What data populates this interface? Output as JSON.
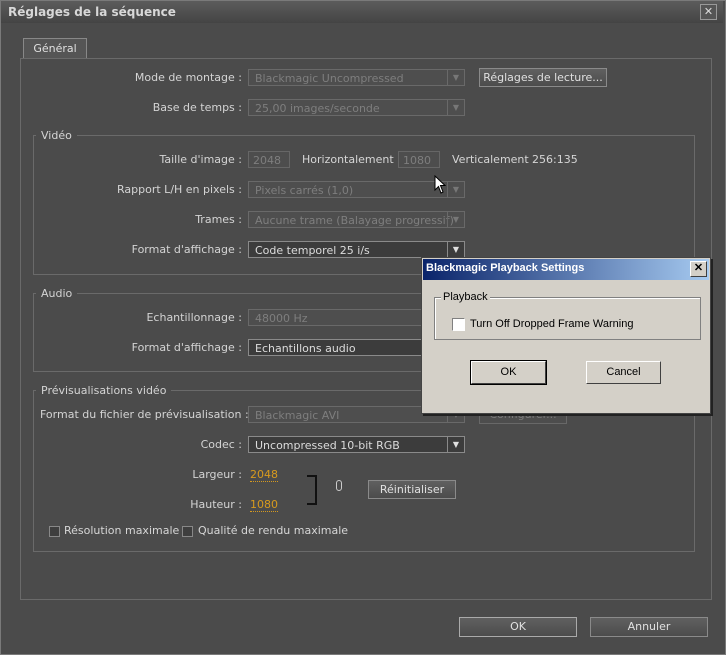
{
  "window": {
    "title": "Réglages de la séquence",
    "close_glyph": "✕"
  },
  "tab": {
    "label": "Général"
  },
  "general": {
    "mode_label": "Mode de montage :",
    "mode_value": "Blackmagic Uncompressed",
    "playback_button": "Réglages de lecture...",
    "timebase_label": "Base de temps :",
    "timebase_value": "25,00 images/seconde"
  },
  "video": {
    "group_title": "Vidéo",
    "frame_size_label": "Taille d'image :",
    "width_value": "2048",
    "horizontal_label": "Horizontalement",
    "height_value": "1080",
    "vertical_label": "Verticalement",
    "ratio": "256:135",
    "pixel_aspect_label": "Rapport L/H en pixels :",
    "pixel_aspect_value": "Pixels carrés (1,0)",
    "fields_label": "Trames :",
    "fields_value": "Aucune trame (Balayage progressif)",
    "display_format_label": "Format d'affichage :",
    "display_format_value": "Code temporel 25 i/s"
  },
  "audio": {
    "group_title": "Audio",
    "sample_rate_label": "Echantillonnage :",
    "sample_rate_value": "48000 Hz",
    "display_format_label": "Format d'affichage :",
    "display_format_value": "Echantillons audio"
  },
  "preview": {
    "group_title": "Prévisualisations vidéo",
    "file_format_label": "Format du fichier de prévisualisation :",
    "file_format_value": "Blackmagic AVI",
    "configure_button": "Configurer...",
    "codec_label": "Codec :",
    "codec_value": "Uncompressed 10-bit RGB",
    "width_label": "Largeur :",
    "width_value": "2048",
    "height_label": "Hauteur :",
    "height_value": "1080",
    "reset_button": "Réinitialiser",
    "max_resolution_label": "Résolution maximale",
    "max_quality_label": "Qualité de rendu maximale"
  },
  "footer": {
    "ok": "OK",
    "cancel": "Annuler"
  },
  "modal": {
    "title": "Blackmagic Playback Settings",
    "close_glyph": "✕",
    "group_title": "Playback",
    "checkbox_label": "Turn Off Dropped Frame Warning",
    "checkbox_checked": false,
    "ok": "OK",
    "cancel": "Cancel"
  },
  "colors": {
    "accent_orange": "#d79a1e",
    "modal_title_start": "#0a246a",
    "modal_title_end": "#a6caf0"
  }
}
